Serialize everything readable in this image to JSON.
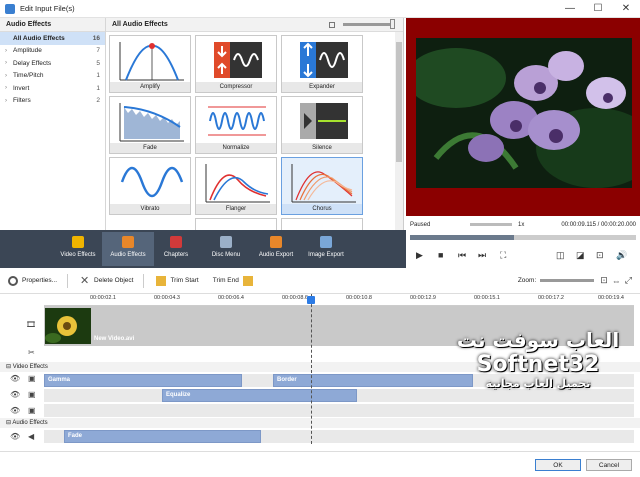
{
  "window": {
    "title": "Edit Input File(s)",
    "min": "—",
    "max": "☐",
    "close": "✕"
  },
  "categories": {
    "header": "Audio Effects",
    "items": [
      {
        "label": "All Audio Effects",
        "count": "16",
        "expander": ""
      },
      {
        "label": "Amplitude",
        "count": "7",
        "expander": "›"
      },
      {
        "label": "Delay Effects",
        "count": "5",
        "expander": "›"
      },
      {
        "label": "Time/Pitch",
        "count": "1",
        "expander": "›"
      },
      {
        "label": "Invert",
        "count": "1",
        "expander": "›"
      },
      {
        "label": "Filters",
        "count": "2",
        "expander": "›"
      }
    ]
  },
  "effects": {
    "header": "All Audio Effects",
    "tiles": [
      {
        "label": "Amplify",
        "icon": "amplify-icon"
      },
      {
        "label": "Compressor",
        "icon": "compressor-icon"
      },
      {
        "label": "Expander",
        "icon": "expander-icon"
      },
      {
        "label": "Fade",
        "icon": "fade-icon"
      },
      {
        "label": "Normalize",
        "icon": "normalize-icon"
      },
      {
        "label": "Silence",
        "icon": "silence-icon"
      },
      {
        "label": "Vibrato",
        "icon": "vibrato-icon"
      },
      {
        "label": "Flanger",
        "icon": "flanger-icon"
      },
      {
        "label": "Chorus",
        "icon": "chorus-icon"
      }
    ],
    "selected": "Chorus"
  },
  "toolbar": {
    "buttons": [
      {
        "label": "Video Effects",
        "icon": "star-icon",
        "color": "#f0b400"
      },
      {
        "label": "Audio Effects",
        "icon": "speaker-icon",
        "color": "#e8872a"
      },
      {
        "label": "Chapters",
        "icon": "bookmark-icon",
        "color": "#d23a3a"
      },
      {
        "label": "Disc Menu",
        "icon": "disc-menu-icon",
        "color": "#9bb0c8"
      },
      {
        "label": "Audio Export",
        "icon": "audio-export-icon",
        "color": "#e8872a"
      },
      {
        "label": "Image Export",
        "icon": "image-export-icon",
        "color": "#7aa7d8"
      }
    ],
    "active": "Audio Effects"
  },
  "player": {
    "status": "Paused",
    "speed": "1x",
    "time": "00:00:09.115 / 00:00:20.000",
    "progress": 0.46
  },
  "timeline_toolbar": {
    "properties": "Properties...",
    "delete": "Delete Object",
    "trim_start": "Trim Start",
    "trim_end": "Trim End",
    "zoom": "Zoom:"
  },
  "ruler": [
    "00:00:02.1",
    "00:00:04.3",
    "00:00:06.4",
    "00:00:08.6",
    "00:00:10.8",
    "00:00:12.9",
    "00:00:15.1",
    "00:00:17.2",
    "00:00:19.4"
  ],
  "tracks": {
    "main_clip": "New Video.avi",
    "video_effects_header": "Video Effects",
    "audio_effects_header": "Audio Effects",
    "video_clips": [
      "Gamma",
      "Border",
      "Equalize"
    ],
    "audio_clips": [
      "Fade"
    ]
  },
  "footer": {
    "ok": "OK",
    "cancel": "Cancel"
  },
  "watermark": {
    "line1": "العاب سوفت نت",
    "line2": "Softnet32",
    "line3": "تحميل العاب مجانية"
  }
}
